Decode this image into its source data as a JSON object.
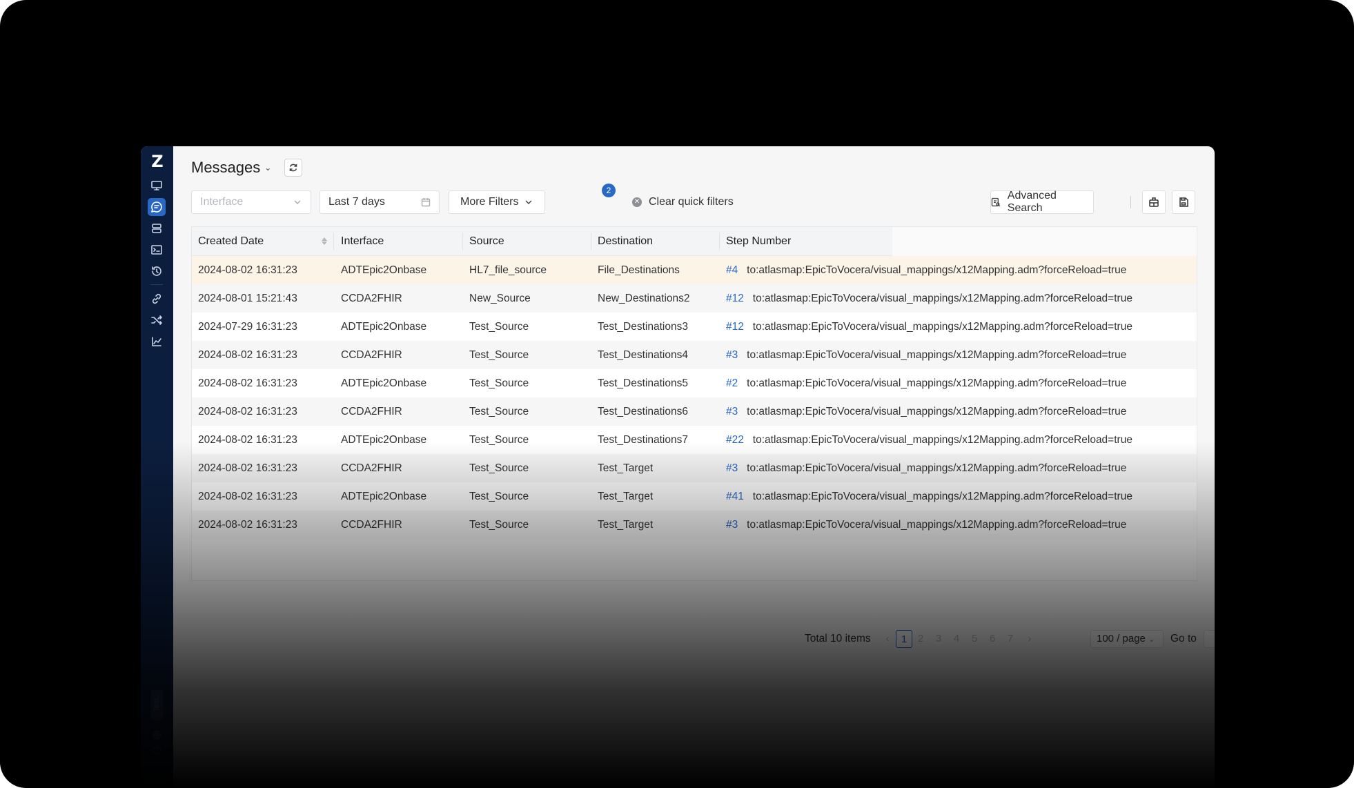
{
  "sidebar": {
    "logo": "Z",
    "items": [
      {
        "icon": "monitor-icon"
      },
      {
        "icon": "messages-icon",
        "active": true
      },
      {
        "icon": "servers-icon"
      },
      {
        "icon": "terminal-icon"
      },
      {
        "icon": "history-icon"
      },
      {
        "icon": "link-icon"
      },
      {
        "icon": "shuffle-icon"
      },
      {
        "icon": "chart-icon"
      }
    ],
    "env_label": "Test",
    "bottom_icons": [
      "globe-icon",
      "help-icon"
    ]
  },
  "header": {
    "title": "Messages"
  },
  "filters": {
    "interface_placeholder": "Interface",
    "date_range": "Last 7 days",
    "more_filters_label": "More Filters",
    "more_filters_count": "2",
    "clear_label": "Clear quick filters",
    "advanced_search_label": "Advanced Search"
  },
  "table": {
    "columns": [
      "Created Date",
      "Interface",
      "Source",
      "Destination",
      "Step Number"
    ],
    "rows": [
      {
        "date": "2024-08-02 16:31:23",
        "interface": "ADTEpic2Onbase",
        "source": "HL7_file_source",
        "destination": "File_Destinations",
        "step": "#4",
        "detail": "to:atlasmap:EpicToVocera/visual_mappings/x12Mapping.adm?forceReload=true"
      },
      {
        "date": "2024-08-01 15:21:43",
        "interface": "CCDA2FHIR",
        "source": "New_Source",
        "destination": "New_Destinations2",
        "step": "#12",
        "detail": "to:atlasmap:EpicToVocera/visual_mappings/x12Mapping.adm?forceReload=true"
      },
      {
        "date": "2024-07-29 16:31:23",
        "interface": "ADTEpic2Onbase",
        "source": "Test_Source",
        "destination": "Test_Destinations3",
        "step": "#12",
        "detail": "to:atlasmap:EpicToVocera/visual_mappings/x12Mapping.adm?forceReload=true"
      },
      {
        "date": "2024-08-02 16:31:23",
        "interface": "CCDA2FHIR",
        "source": "Test_Source",
        "destination": "Test_Destinations4",
        "step": "#3",
        "detail": "to:atlasmap:EpicToVocera/visual_mappings/x12Mapping.adm?forceReload=true"
      },
      {
        "date": "2024-08-02 16:31:23",
        "interface": "ADTEpic2Onbase",
        "source": "Test_Source",
        "destination": "Test_Destinations5",
        "step": "#2",
        "detail": "to:atlasmap:EpicToVocera/visual_mappings/x12Mapping.adm?forceReload=true"
      },
      {
        "date": "2024-08-02 16:31:23",
        "interface": "CCDA2FHIR",
        "source": "Test_Source",
        "destination": "Test_Destinations6",
        "step": "#3",
        "detail": "to:atlasmap:EpicToVocera/visual_mappings/x12Mapping.adm?forceReload=true"
      },
      {
        "date": "2024-08-02 16:31:23",
        "interface": "ADTEpic2Onbase",
        "source": "Test_Source",
        "destination": "Test_Destinations7",
        "step": "#22",
        "detail": "to:atlasmap:EpicToVocera/visual_mappings/x12Mapping.adm?forceReload=true"
      },
      {
        "date": "2024-08-02 16:31:23",
        "interface": "CCDA2FHIR",
        "source": "Test_Source",
        "destination": "Test_Target",
        "step": "#3",
        "detail": "to:atlasmap:EpicToVocera/visual_mappings/x12Mapping.adm?forceReload=true"
      },
      {
        "date": "2024-08-02 16:31:23",
        "interface": "ADTEpic2Onbase",
        "source": "Test_Source",
        "destination": "Test_Target",
        "step": "#41",
        "detail": "to:atlasmap:EpicToVocera/visual_mappings/x12Mapping.adm?forceReload=true"
      },
      {
        "date": "2024-08-02 16:31:23",
        "interface": "CCDA2FHIR",
        "source": "Test_Source",
        "destination": "Test_Target",
        "step": "#3",
        "detail": "to:atlasmap:EpicToVocera/visual_mappings/x12Mapping.adm?forceReload=true"
      }
    ]
  },
  "pagination": {
    "total_label": "Total 10 items",
    "pages": [
      "1",
      "2",
      "3",
      "4",
      "5",
      "6",
      "7"
    ],
    "current_page": "1",
    "page_size": "100 / page",
    "goto_label": "Go to"
  },
  "colors": {
    "accent": "#2a68c6",
    "sidebar_bg": "#0c1e3e",
    "highlight_row": "#fdf4e8"
  }
}
